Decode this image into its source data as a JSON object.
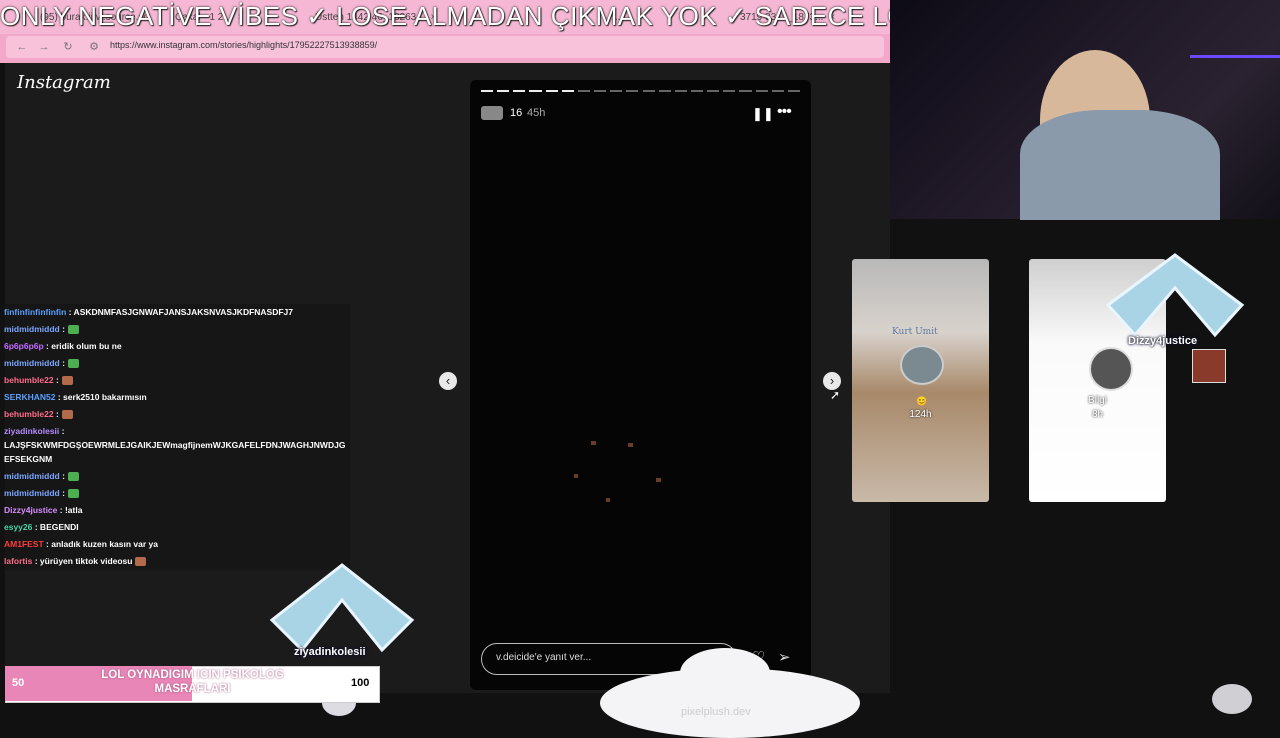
{
  "banner": {
    "text": "ONLY NEGATİVE VİBES ✓ LOSE ALMADAN ÇIKMAK YOK ✓ SADECE LOSE ✓"
  },
  "browser": {
    "tabs": [
      "(95) burak.ii vi.source.com",
      "Çakal - 1 2...",
      "Üstten 1442 46_18263...",
      "...",
      "3719 3315_1873..."
    ],
    "url": "https://www.instagram.com/stories/highlights/17952227513938859/"
  },
  "instagram": {
    "logo": "Instagram",
    "story": {
      "count": "16",
      "age": "45h",
      "reply_placeholder": "v.deicide'e yanıt ver...",
      "segments_total": 20,
      "segments_done": 6
    },
    "next_highlights": [
      {
        "label": "124h",
        "caption": "Kurt Umit"
      },
      {
        "label": "Bilgi",
        "sublabel": "8h"
      }
    ]
  },
  "chat": [
    {
      "user": "finfinfinfinfinfin",
      "color": "#5aa0ff",
      "text": " : ASKDNMFASJGNWAFJANSJAKSNVASJKDFNASDFJ7"
    },
    {
      "user": "midmidmiddd",
      "color": "#7aa6ff",
      "text": " :",
      "emote": "#4caf50"
    },
    {
      "user": "6p6p6p6p",
      "color": "#c26bff",
      "text": " : eridik olum bu ne"
    },
    {
      "user": "midmidmiddd",
      "color": "#7aa6ff",
      "text": " :",
      "emote": "#4caf50"
    },
    {
      "user": "behumble22",
      "color": "#ff6b8b",
      "text": " :",
      "emote": "#b36a4a"
    },
    {
      "user": "SERKHAN52",
      "color": "#5aa0ff",
      "text": " : serk2510 bakarmısın"
    },
    {
      "user": "behumble22",
      "color": "#ff6b8b",
      "text": " :",
      "emote": "#b36a4a"
    },
    {
      "user": "ziyadinkolesii",
      "color": "#b58cff",
      "text": " :"
    },
    {
      "user": "",
      "color": "#fff",
      "text": "LAJŞFSKWMFDGŞOEWRMLEJGAIKJEWmagfijnemWJKGAFELFDNJWAGHJNWDJG"
    },
    {
      "user": "",
      "color": "#fff",
      "text": "EFSEKGNM"
    },
    {
      "user": "midmidmiddd",
      "color": "#7aa6ff",
      "text": " :",
      "emote": "#4caf50"
    },
    {
      "user": "midmidmiddd",
      "color": "#7aa6ff",
      "text": " :",
      "emote": "#4caf50"
    },
    {
      "user": "Dizzy4justice",
      "color": "#d68cff",
      "text": " : !atla"
    },
    {
      "user": "esyy26",
      "color": "#4cd6a6",
      "text": " : BEGENDI"
    },
    {
      "user": "AM1FEST",
      "color": "#ff3b3b",
      "text": " : anladık kuzen kasın var ya"
    },
    {
      "user": "lafortis",
      "color": "#ff6b8b",
      "text": " : yürüyen tiktok videosu",
      "emote": "#b36a4a"
    }
  ],
  "overlay_names": {
    "left": "ziyadinkolesii",
    "right": "Dizzy4justice"
  },
  "goal": {
    "start": "50",
    "title": "LOL OYNADIGIM ICIN PSIKOLOG MASRAFLARI",
    "end": "100",
    "progress": 0.5
  },
  "watermark": "pixelplush.dev"
}
